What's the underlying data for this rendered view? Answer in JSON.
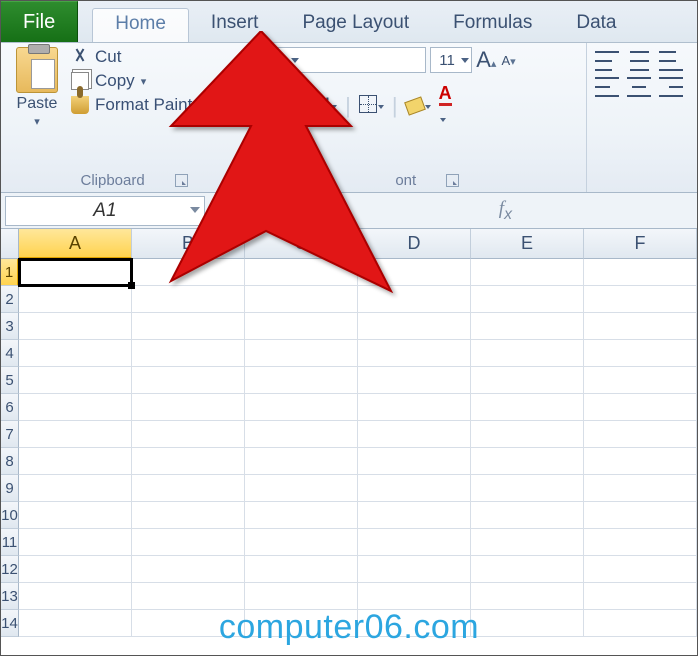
{
  "tabs": {
    "file": "File",
    "home": "Home",
    "insert": "Insert",
    "page_layout": "Page Layout",
    "formulas": "Formulas",
    "data": "Data",
    "active": "home"
  },
  "ribbon": {
    "clipboard": {
      "label": "Clipboard",
      "paste": "Paste",
      "cut": "Cut",
      "copy": "Copy",
      "format_painter": "Format Painter"
    },
    "font": {
      "label": "Font",
      "font_name": "",
      "font_size": "11"
    }
  },
  "namebox": "A1",
  "formula_bar": "",
  "columns": [
    "A",
    "B",
    "C",
    "D",
    "E",
    "F"
  ],
  "rows": [
    "1",
    "2",
    "3",
    "4",
    "5",
    "6",
    "7",
    "8",
    "9",
    "10",
    "11",
    "12",
    "13",
    "14"
  ],
  "selected": {
    "col": "A",
    "row": "1"
  },
  "watermark": "computer06.com"
}
